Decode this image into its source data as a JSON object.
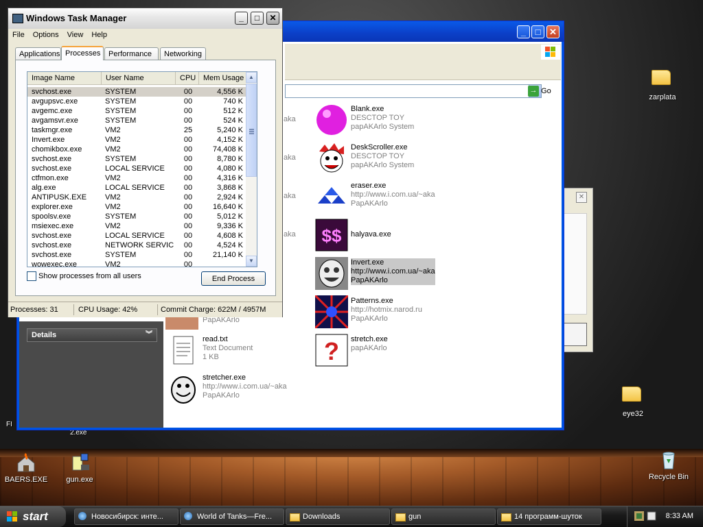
{
  "desktop": {
    "icons": [
      {
        "label": "zarplata"
      },
      {
        "label": "eye32"
      },
      {
        "label": "BAERS.EXE"
      },
      {
        "label": "gun.exe"
      },
      {
        "label": "Recycle Bin"
      }
    ],
    "edge_labels": [
      "2.exe",
      "FI"
    ]
  },
  "explorer": {
    "go_label": "Go",
    "details_label": "Details",
    "files": [
      {
        "name": "Blank.exe",
        "line2": "DESCTOP TOY",
        "line3": "papAKArlo System"
      },
      {
        "name": "DeskScroller.exe",
        "line2": "DESCTOP TOY",
        "line3": "papAKArlo System"
      },
      {
        "name": "eraser.exe",
        "line2": "http://www.i.com.ua/~aka",
        "line3": "PapAKArlo"
      },
      {
        "name": "halyava.exe",
        "line2": "",
        "line3": ""
      },
      {
        "name": "Invert.exe",
        "line2": "http://www.i.com.ua/~aka",
        "line3": "PapAKArlo"
      },
      {
        "name": "Patterns.exe",
        "line2": "http://hotmix.narod.ru",
        "line3": "PapAKArlo"
      },
      {
        "name": "stretch.exe",
        "line2": "papAKArlo",
        "line3": ""
      },
      {
        "name": "read.txt",
        "line2": "Text Document",
        "line3": "1 KB"
      },
      {
        "name": "stretcher.exe",
        "line2": "http://www.i.com.ua/~aka",
        "line3": "PapAKArlo"
      }
    ],
    "partial_texts": [
      "aka",
      "aka",
      "aka",
      "aka",
      "PapAKArlo"
    ]
  },
  "taskmgr": {
    "title": "Windows Task Manager",
    "menu": [
      "File",
      "Options",
      "View",
      "Help"
    ],
    "tabs": [
      "Applications",
      "Processes",
      "Performance",
      "Networking"
    ],
    "active_tab": "Processes",
    "columns": [
      "Image Name",
      "User Name",
      "CPU",
      "Mem Usage"
    ],
    "processes": [
      [
        "svchost.exe",
        "SYSTEM",
        "00",
        "4,556 K"
      ],
      [
        "avgupsvc.exe",
        "SYSTEM",
        "00",
        "740 K"
      ],
      [
        "avgemc.exe",
        "SYSTEM",
        "00",
        "512 K"
      ],
      [
        "avgamsvr.exe",
        "SYSTEM",
        "00",
        "524 K"
      ],
      [
        "taskmgr.exe",
        "VM2",
        "25",
        "5,240 K"
      ],
      [
        "Invert.exe",
        "VM2",
        "00",
        "4,152 K"
      ],
      [
        "chomikbox.exe",
        "VM2",
        "00",
        "74,408 K"
      ],
      [
        "svchost.exe",
        "SYSTEM",
        "00",
        "8,780 K"
      ],
      [
        "svchost.exe",
        "LOCAL SERVICE",
        "00",
        "4,080 K"
      ],
      [
        "ctfmon.exe",
        "VM2",
        "00",
        "4,316 K"
      ],
      [
        "alg.exe",
        "LOCAL SERVICE",
        "00",
        "3,868 K"
      ],
      [
        "ANTIPUSK.EXE",
        "VM2",
        "00",
        "2,924 K"
      ],
      [
        "explorer.exe",
        "VM2",
        "00",
        "16,640 K"
      ],
      [
        "spoolsv.exe",
        "SYSTEM",
        "00",
        "5,012 K"
      ],
      [
        "msiexec.exe",
        "VM2",
        "00",
        "9,336 K"
      ],
      [
        "svchost.exe",
        "LOCAL SERVICE",
        "00",
        "4,608 K"
      ],
      [
        "svchost.exe",
        "NETWORK SERVICE",
        "00",
        "4,524 K"
      ],
      [
        "svchost.exe",
        "SYSTEM",
        "00",
        "21,140 K"
      ],
      [
        "wowexec.exe",
        "VM2",
        "00",
        ""
      ]
    ],
    "show_all_label": "Show processes from all users",
    "end_process_label": "End Process",
    "status": {
      "processes": "Processes: 31",
      "cpu": "CPU Usage: 42%",
      "commit": "Commit Charge: 622M / 4957M"
    }
  },
  "taskbar": {
    "start_label": "start",
    "buttons": [
      {
        "label": "Новосибирск: инте...",
        "icon": "browser-icon"
      },
      {
        "label": "World of Tanks—Fre...",
        "icon": "browser-icon"
      },
      {
        "label": "Downloads",
        "icon": "folder-icon"
      },
      {
        "label": "gun",
        "icon": "folder-icon"
      },
      {
        "label": "14 программ-шуток",
        "icon": "folder-icon"
      }
    ],
    "clock": "8:33 AM"
  }
}
